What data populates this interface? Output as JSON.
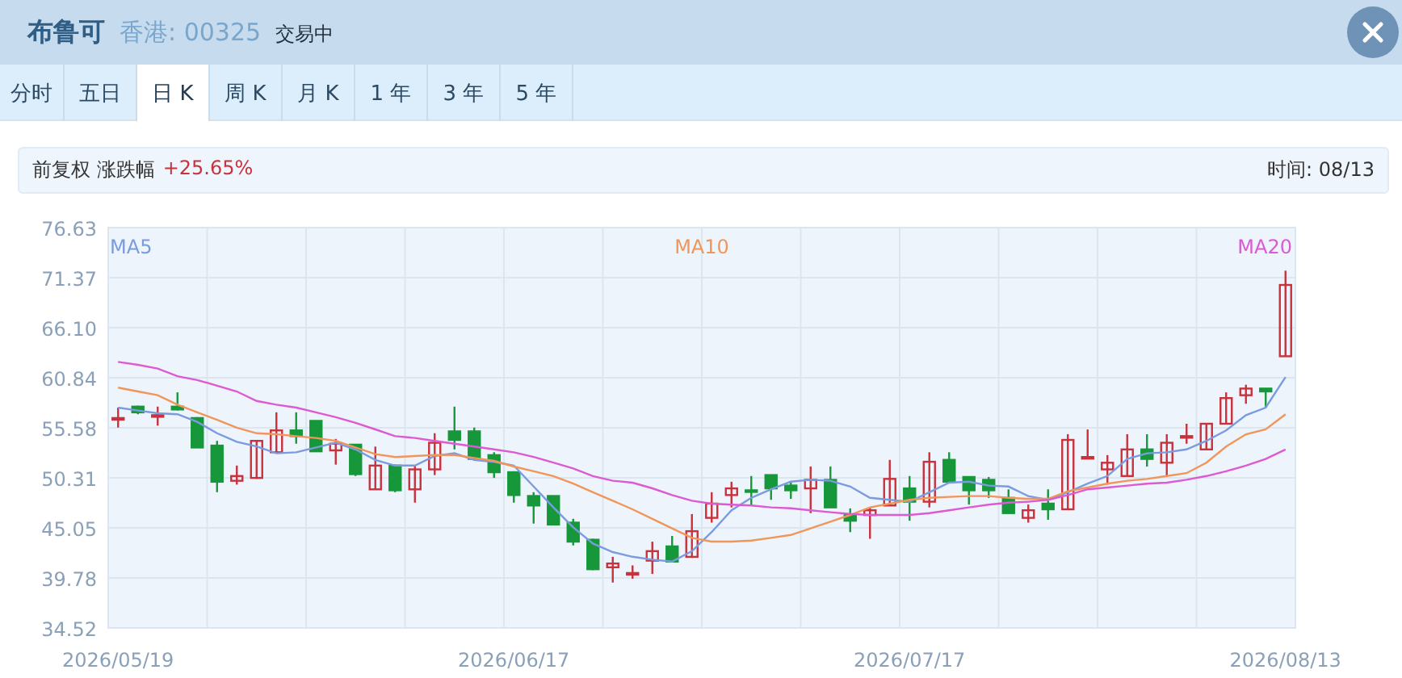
{
  "header": {
    "name": "布鲁可",
    "market_code": "香港: 00325",
    "status": "交易中"
  },
  "tabs": [
    {
      "label": "分时",
      "selected": false
    },
    {
      "label": "五日",
      "selected": false
    },
    {
      "label": "日 K",
      "selected": true
    },
    {
      "label": "周 K",
      "selected": false
    },
    {
      "label": "月 K",
      "selected": false
    },
    {
      "label": "1 年",
      "selected": false
    },
    {
      "label": "3 年",
      "selected": false
    },
    {
      "label": "5 年",
      "selected": false
    }
  ],
  "info_bar": {
    "label": "前复权 涨跌幅",
    "change": "+25.65%",
    "time": "时间: 08/13"
  },
  "chart": {
    "chart_data": {
      "type": "candlestick",
      "categories": [
        "2026/05/19",
        null,
        null,
        null,
        null,
        null,
        null,
        null,
        null,
        null,
        null,
        null,
        null,
        null,
        null,
        null,
        null,
        null,
        null,
        null,
        "2026/06/17",
        null,
        null,
        null,
        null,
        null,
        null,
        null,
        null,
        null,
        null,
        null,
        null,
        null,
        null,
        null,
        null,
        null,
        null,
        null,
        "2026/07/17",
        null,
        null,
        null,
        null,
        null,
        null,
        null,
        null,
        null,
        null,
        null,
        null,
        null,
        null,
        null,
        null,
        null,
        null,
        "2026/08/13"
      ],
      "ylim": [
        34.52,
        76.63
      ],
      "grid": true,
      "yticks": [
        {
          "value": 76.63,
          "label": "76.63"
        },
        {
          "value": 71.37,
          "label": "71.37"
        },
        {
          "value": 66.1,
          "label": "66.10"
        },
        {
          "value": 60.84,
          "label": "60.84"
        },
        {
          "value": 55.58,
          "label": "55.58"
        },
        {
          "value": 50.31,
          "label": "50.31"
        },
        {
          "value": 45.05,
          "label": "45.05"
        },
        {
          "value": 39.78,
          "label": "39.78"
        },
        {
          "value": 34.52,
          "label": "34.52"
        }
      ],
      "ohlc": [
        [
          56.6,
          57.7,
          55.6,
          56.6
        ],
        [
          57.8,
          57.9,
          57.0,
          57.2
        ],
        [
          56.9,
          57.8,
          55.8,
          56.9
        ],
        [
          57.8,
          59.3,
          57.4,
          57.5
        ],
        [
          56.6,
          56.7,
          53.5,
          53.5
        ],
        [
          53.7,
          54.2,
          48.8,
          49.9
        ],
        [
          50.0,
          51.6,
          49.6,
          50.5
        ],
        [
          50.3,
          54.2,
          50.2,
          54.2
        ],
        [
          53.0,
          57.2,
          53.0,
          55.3
        ],
        [
          55.3,
          57.2,
          53.9,
          54.7
        ],
        [
          56.3,
          56.3,
          53.1,
          53.1
        ],
        [
          53.2,
          54.4,
          51.7,
          53.9
        ],
        [
          53.8,
          53.8,
          50.5,
          50.7
        ],
        [
          49.1,
          53.6,
          49.1,
          51.6
        ],
        [
          51.6,
          51.7,
          48.8,
          49.0
        ],
        [
          49.1,
          51.6,
          47.7,
          51.2
        ],
        [
          51.2,
          55.0,
          50.6,
          54.0
        ],
        [
          55.2,
          57.8,
          53.3,
          54.3
        ],
        [
          55.2,
          55.6,
          52.3,
          52.3
        ],
        [
          52.7,
          53.0,
          50.3,
          50.9
        ],
        [
          50.9,
          51.0,
          47.7,
          48.5
        ],
        [
          48.4,
          48.8,
          45.5,
          47.4
        ],
        [
          48.4,
          48.4,
          45.4,
          45.4
        ],
        [
          45.6,
          46.0,
          43.2,
          43.6
        ],
        [
          43.8,
          43.9,
          40.6,
          40.7
        ],
        [
          40.9,
          42.0,
          39.3,
          41.3
        ],
        [
          40.3,
          41.1,
          39.7,
          40.3
        ],
        [
          41.6,
          43.6,
          40.2,
          42.6
        ],
        [
          43.1,
          44.2,
          41.5,
          41.5
        ],
        [
          42.0,
          46.5,
          41.9,
          44.7
        ],
        [
          46.1,
          48.8,
          45.6,
          47.6
        ],
        [
          48.5,
          49.9,
          47.2,
          49.2
        ],
        [
          49.0,
          50.5,
          47.4,
          48.9
        ],
        [
          50.6,
          50.6,
          48.0,
          49.2
        ],
        [
          49.5,
          49.9,
          48.1,
          49.0
        ],
        [
          49.2,
          51.5,
          46.6,
          50.1
        ],
        [
          50.1,
          51.5,
          47.2,
          47.2
        ],
        [
          46.4,
          47.1,
          44.6,
          45.8
        ],
        [
          46.4,
          47.2,
          43.9,
          46.9
        ],
        [
          47.4,
          52.2,
          47.4,
          50.2
        ],
        [
          49.2,
          50.5,
          45.8,
          47.8
        ],
        [
          47.8,
          53.0,
          47.2,
          52.0
        ],
        [
          52.2,
          53.0,
          49.9,
          49.9
        ],
        [
          50.4,
          50.4,
          47.5,
          49.0
        ],
        [
          50.1,
          50.4,
          48.2,
          49.0
        ],
        [
          48.2,
          49.1,
          46.6,
          46.6
        ],
        [
          46.1,
          47.5,
          45.6,
          46.9
        ],
        [
          47.6,
          49.1,
          45.9,
          47.0
        ],
        [
          47.0,
          54.9,
          47.0,
          54.3
        ],
        [
          52.5,
          55.4,
          52.4,
          52.5
        ],
        [
          51.2,
          52.7,
          49.6,
          51.9
        ],
        [
          50.5,
          54.9,
          50.5,
          53.3
        ],
        [
          53.3,
          54.9,
          51.5,
          52.3
        ],
        [
          51.9,
          54.9,
          50.5,
          54.0
        ],
        [
          54.7,
          56.0,
          53.9,
          54.7
        ],
        [
          53.3,
          56.0,
          53.3,
          56.0
        ],
        [
          56.0,
          59.3,
          56.0,
          58.7
        ],
        [
          59.0,
          60.1,
          58.1,
          59.7
        ],
        [
          59.7,
          59.7,
          57.7,
          59.4
        ],
        [
          63.1,
          72.1,
          63.1,
          70.6
        ]
      ],
      "series": [
        {
          "name": "MA5",
          "type": "line",
          "color": "#7b9be0",
          "values": [
            57.7,
            57.4,
            57.1,
            57.0,
            56.2,
            55.0,
            54.1,
            53.6,
            52.9,
            53.0,
            53.5,
            54.0,
            53.3,
            52.2,
            51.6,
            51.6,
            52.6,
            52.9,
            52.2,
            52.0,
            51.6,
            49.4,
            47.2,
            45.1,
            43.4,
            42.5,
            42.0,
            41.7,
            41.5,
            42.6,
            44.6,
            46.9,
            48.2,
            49.1,
            49.9,
            50.1,
            50.0,
            49.4,
            48.2,
            48.0,
            47.8,
            48.8,
            49.8,
            49.9,
            49.5,
            49.4,
            48.4,
            48.0,
            48.8,
            49.7,
            50.5,
            52.3,
            52.9,
            53.0,
            53.3,
            54.2,
            55.3,
            56.9,
            57.7,
            60.9
          ]
        },
        {
          "name": "MA10",
          "type": "line",
          "color": "#f0965a",
          "values": [
            59.8,
            59.4,
            59.0,
            58.0,
            57.2,
            56.4,
            55.6,
            55.0,
            54.9,
            54.7,
            54.5,
            54.2,
            53.5,
            52.8,
            52.5,
            52.6,
            52.7,
            52.7,
            52.4,
            52.1,
            51.5,
            51.0,
            50.5,
            49.7,
            48.8,
            47.9,
            47.0,
            46.0,
            45.0,
            44.0,
            43.6,
            43.6,
            43.7,
            44.0,
            44.3,
            45.0,
            45.7,
            46.4,
            47.2,
            47.6,
            48.0,
            48.2,
            48.3,
            48.4,
            48.4,
            48.2,
            48.1,
            48.1,
            48.9,
            49.3,
            49.7,
            50.0,
            50.2,
            50.5,
            50.8,
            51.9,
            53.6,
            54.9,
            55.4,
            57.0
          ]
        },
        {
          "name": "MA20",
          "type": "line",
          "color": "#dc5ad2",
          "values": [
            62.5,
            62.2,
            61.8,
            61.0,
            60.6,
            60.0,
            59.4,
            58.4,
            58.0,
            57.7,
            57.2,
            56.7,
            56.1,
            55.4,
            54.7,
            54.5,
            54.2,
            53.9,
            53.6,
            53.3,
            53.0,
            52.5,
            51.9,
            51.3,
            50.5,
            50.0,
            49.8,
            49.2,
            48.5,
            47.9,
            47.6,
            47.5,
            47.4,
            47.2,
            47.1,
            46.9,
            46.7,
            46.5,
            46.4,
            46.4,
            46.4,
            46.6,
            46.9,
            47.2,
            47.5,
            47.7,
            47.8,
            48.0,
            48.5,
            49.1,
            49.3,
            49.5,
            49.7,
            49.8,
            50.1,
            50.5,
            51.0,
            51.6,
            52.3,
            53.3
          ]
        }
      ]
    }
  }
}
